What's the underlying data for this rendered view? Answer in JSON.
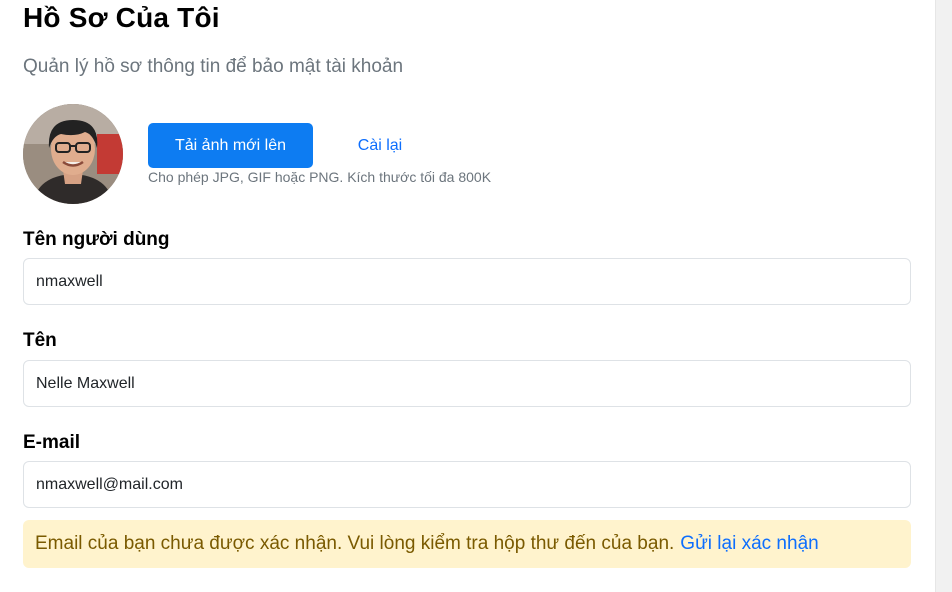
{
  "header": {
    "title": "Hồ Sơ Của Tôi",
    "subtitle": "Quản lý hồ sơ thông tin để bảo mật tài khoản"
  },
  "avatar": {
    "icon": "user-photo"
  },
  "photo": {
    "upload_label": "Tải ảnh mới lên",
    "reset_label": "Cài lại",
    "hint": "Cho phép JPG, GIF hoặc PNG. Kích thước tối đa 800K"
  },
  "form": {
    "username": {
      "label": "Tên người dùng",
      "value": "nmaxwell"
    },
    "name": {
      "label": "Tên",
      "value": "Nelle Maxwell"
    },
    "email": {
      "label": "E-mail",
      "value": "nmaxwell@mail.com"
    }
  },
  "alert": {
    "message": "Email của bạn chưa được xác nhận. Vui lòng kiểm tra hộp thư đến của bạn.",
    "link": "Gửi lại xác nhận"
  },
  "colors": {
    "primary": "#0d7cf2",
    "link": "#0d6efd",
    "alert_bg": "#fff3cd",
    "alert_text": "#7a5a00"
  }
}
